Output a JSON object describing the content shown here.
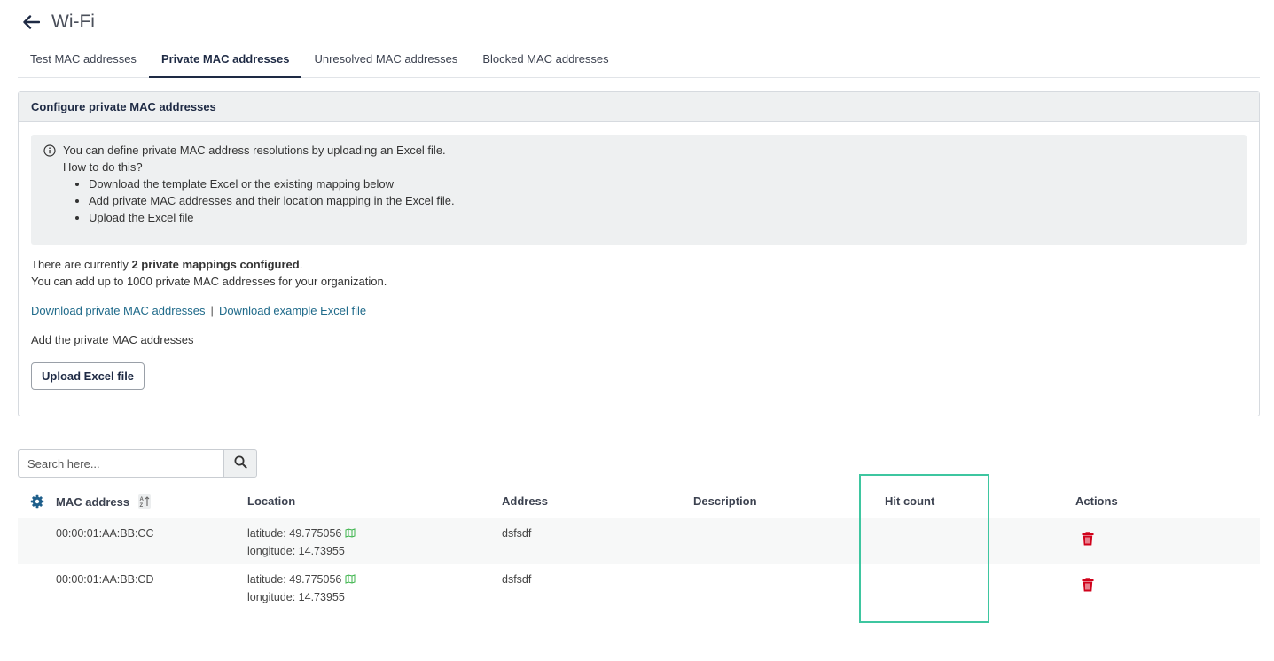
{
  "header": {
    "title": "Wi-Fi"
  },
  "tabs": [
    {
      "label": "Test MAC addresses",
      "active": false
    },
    {
      "label": "Private MAC addresses",
      "active": true
    },
    {
      "label": "Unresolved MAC addresses",
      "active": false
    },
    {
      "label": "Blocked MAC addresses",
      "active": false
    }
  ],
  "panel": {
    "title": "Configure private MAC addresses",
    "info": {
      "line1": "You can define private MAC address resolutions by uploading an Excel file.",
      "line2": "How to do this?",
      "bullets": [
        "Download the template Excel or the existing mapping below",
        "Add private MAC addresses and their location mapping in the Excel file.",
        "Upload the Excel file"
      ]
    },
    "status_prefix": "There are currently ",
    "status_bold": "2 private mappings configured",
    "status_suffix": ".",
    "limit_text": "You can add up to 1000 private MAC addresses for your organization.",
    "download_private_link": "Download private MAC addresses",
    "separator": "|",
    "download_example_link": "Download example Excel file",
    "add_label": "Add the private MAC addresses",
    "upload_button": "Upload Excel file"
  },
  "search": {
    "placeholder": "Search here..."
  },
  "table": {
    "columns": {
      "mac": "MAC address",
      "location": "Location",
      "address": "Address",
      "description": "Description",
      "hit_count": "Hit count",
      "actions": "Actions"
    },
    "rows": [
      {
        "mac": "00:00:01:AA:BB:CC",
        "latitude": "latitude: 49.775056",
        "longitude": "longitude: 14.73955",
        "address": "dsfsdf",
        "description": "",
        "hit_count": ""
      },
      {
        "mac": "00:00:01:AA:BB:CD",
        "latitude": "latitude: 49.775056",
        "longitude": "longitude: 14.73955",
        "address": "dsfsdf",
        "description": "",
        "hit_count": ""
      }
    ]
  },
  "colors": {
    "accent": "#1e2a44",
    "link": "#1f6a8a",
    "gear": "#1f5f8b",
    "delete": "#d0021b",
    "map": "#3cb44b",
    "highlight": "#3ec6a0"
  },
  "icons": {
    "back": "arrow-left-icon",
    "info": "info-circle-icon",
    "search": "search-icon",
    "settings": "gear-icon",
    "sort": "sort-az-icon",
    "map": "map-icon",
    "delete": "trash-icon"
  }
}
